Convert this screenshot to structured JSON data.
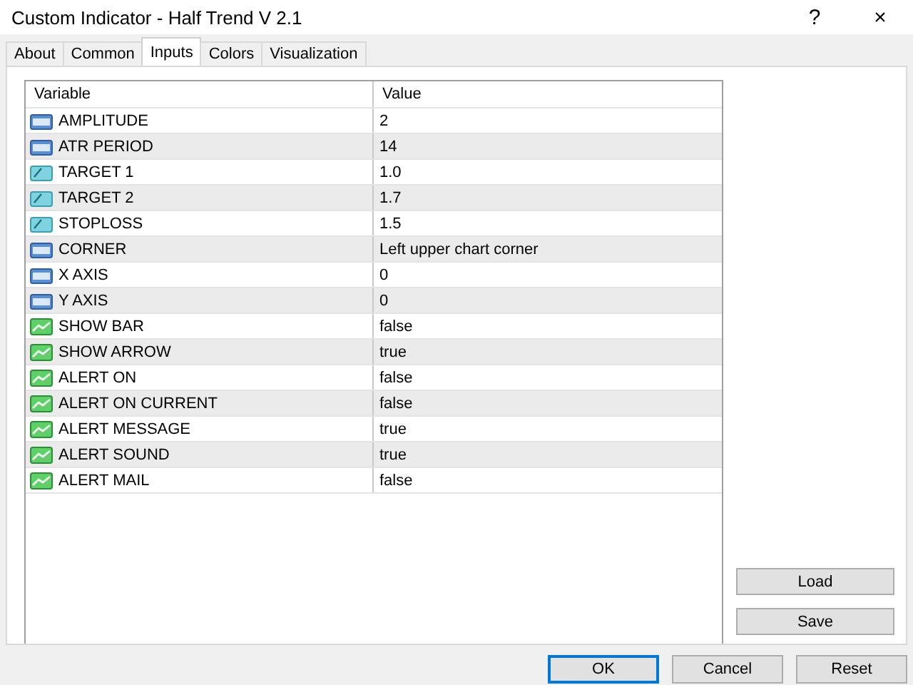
{
  "window": {
    "title": "Custom Indicator - Half Trend V 2.1",
    "help": "?",
    "close": "×"
  },
  "tabs": [
    {
      "label": "About",
      "selected": false
    },
    {
      "label": "Common",
      "selected": false
    },
    {
      "label": "Inputs",
      "selected": true
    },
    {
      "label": "Colors",
      "selected": false
    },
    {
      "label": "Visualization",
      "selected": false
    }
  ],
  "table": {
    "columns": [
      "Variable",
      "Value"
    ],
    "rows": [
      {
        "kind": "int",
        "variable": "AMPLITUDE",
        "value": "2"
      },
      {
        "kind": "int",
        "variable": "ATR PERIOD",
        "value": "14"
      },
      {
        "kind": "double",
        "variable": "TARGET 1",
        "value": "1.0"
      },
      {
        "kind": "double",
        "variable": "TARGET 2",
        "value": "1.7"
      },
      {
        "kind": "double",
        "variable": "STOPLOSS",
        "value": "1.5"
      },
      {
        "kind": "int",
        "variable": "CORNER",
        "value": "Left upper chart corner"
      },
      {
        "kind": "int",
        "variable": "X AXIS",
        "value": "0"
      },
      {
        "kind": "int",
        "variable": "Y AXIS",
        "value": "0"
      },
      {
        "kind": "bool",
        "variable": "SHOW BAR",
        "value": "false"
      },
      {
        "kind": "bool",
        "variable": "SHOW ARROW",
        "value": "true"
      },
      {
        "kind": "bool",
        "variable": "ALERT ON",
        "value": "false"
      },
      {
        "kind": "bool",
        "variable": "ALERT ON CURRENT",
        "value": "false"
      },
      {
        "kind": "bool",
        "variable": "ALERT MESSAGE",
        "value": "true"
      },
      {
        "kind": "bool",
        "variable": "ALERT SOUND",
        "value": "true"
      },
      {
        "kind": "bool",
        "variable": "ALERT MAIL",
        "value": "false"
      }
    ]
  },
  "side_buttons": [
    "Load",
    "Save"
  ],
  "buttons": [
    {
      "label": "OK",
      "default": true
    },
    {
      "label": "Cancel",
      "default": false
    },
    {
      "label": "Reset",
      "default": false
    }
  ]
}
